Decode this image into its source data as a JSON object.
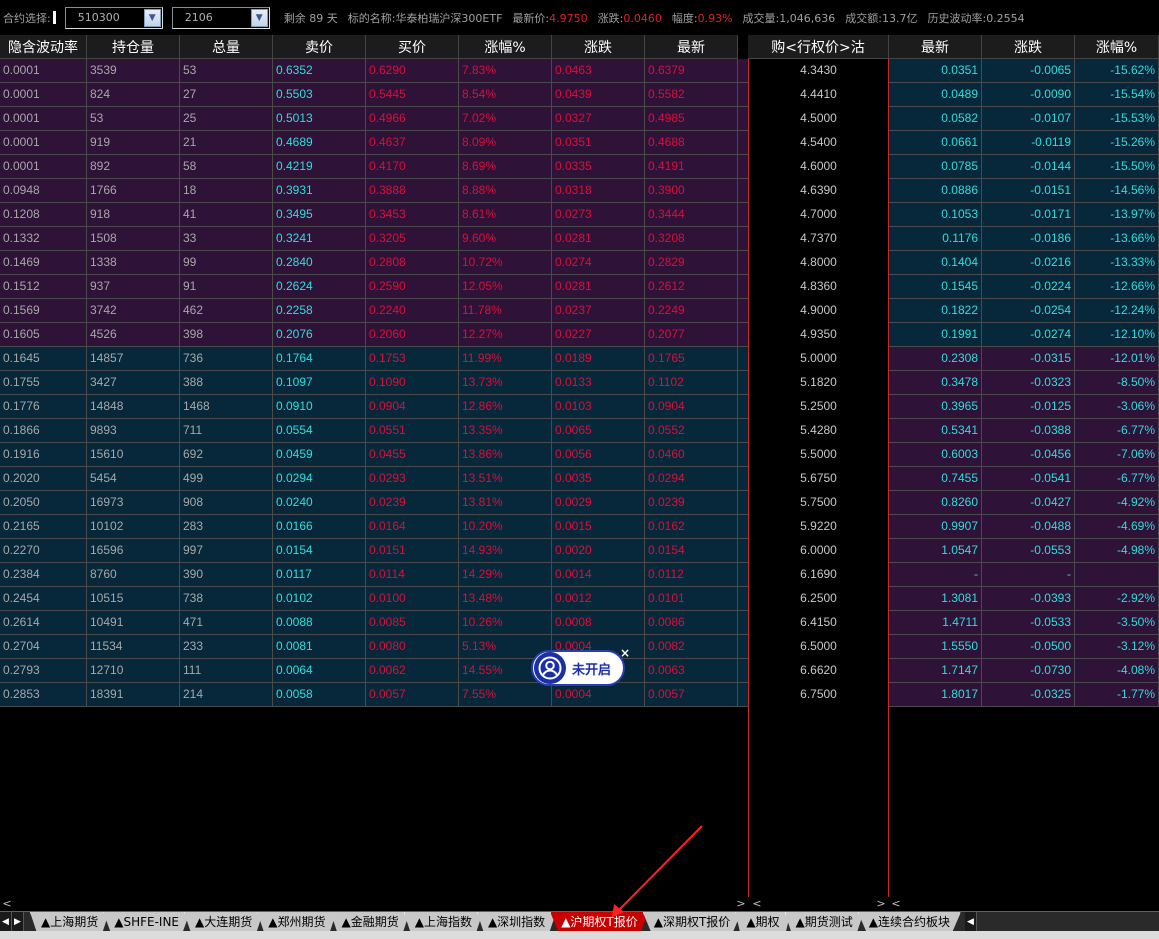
{
  "topbar": {
    "contract_label": "合约选择:",
    "underlying_code": "510300",
    "month_code": "2106",
    "remaining": "剩余 89 天",
    "target_label": "标的名称:",
    "target_name": "华泰柏瑞沪深300ETF",
    "latest_label": "最新价:",
    "latest_value": "4.9750",
    "change_label": "涨跌:",
    "change_value": "0.0460",
    "amp_label": "幅度:",
    "amp_value": "0.93%",
    "volume_label": "成交量:",
    "volume_value": "1,046,636",
    "turnover_label": "成交额:",
    "turnover_value": "13.7亿",
    "hv_label": "历史波动率:",
    "hv_value": "0.2554"
  },
  "headers": {
    "call": [
      "隐含波动率",
      "持仓量",
      "总量",
      "卖价",
      "买价",
      "涨幅%",
      "涨跌",
      "最新"
    ],
    "strike": "购<行权价>沽",
    "put": [
      "最新",
      "涨跌",
      "涨幅%"
    ]
  },
  "rows": [
    {
      "iv": "0.0001",
      "oi": "3539",
      "vol": "53",
      "ask": "0.6352",
      "bid": "0.6290",
      "pct": "7.83%",
      "chg": "0.0463",
      "last": "0.6379",
      "strike": "4.3430",
      "p_last": "0.0351",
      "p_chg": "-0.0065",
      "p_pct": "-15.62%"
    },
    {
      "iv": "0.0001",
      "oi": "824",
      "vol": "27",
      "ask": "0.5503",
      "bid": "0.5445",
      "pct": "8.54%",
      "chg": "0.0439",
      "last": "0.5582",
      "strike": "4.4410",
      "p_last": "0.0489",
      "p_chg": "-0.0090",
      "p_pct": "-15.54%"
    },
    {
      "iv": "0.0001",
      "oi": "53",
      "vol": "25",
      "ask": "0.5013",
      "bid": "0.4966",
      "pct": "7.02%",
      "chg": "0.0327",
      "last": "0.4985",
      "strike": "4.5000",
      "p_last": "0.0582",
      "p_chg": "-0.0107",
      "p_pct": "-15.53%"
    },
    {
      "iv": "0.0001",
      "oi": "919",
      "vol": "21",
      "ask": "0.4689",
      "bid": "0.4637",
      "pct": "8.09%",
      "chg": "0.0351",
      "last": "0.4688",
      "strike": "4.5400",
      "p_last": "0.0661",
      "p_chg": "-0.0119",
      "p_pct": "-15.26%"
    },
    {
      "iv": "0.0001",
      "oi": "892",
      "vol": "58",
      "ask": "0.4219",
      "bid": "0.4170",
      "pct": "8.69%",
      "chg": "0.0335",
      "last": "0.4191",
      "strike": "4.6000",
      "p_last": "0.0785",
      "p_chg": "-0.0144",
      "p_pct": "-15.50%"
    },
    {
      "iv": "0.0948",
      "oi": "1766",
      "vol": "18",
      "ask": "0.3931",
      "bid": "0.3888",
      "pct": "8.88%",
      "chg": "0.0318",
      "last": "0.3900",
      "strike": "4.6390",
      "p_last": "0.0886",
      "p_chg": "-0.0151",
      "p_pct": "-14.56%"
    },
    {
      "iv": "0.1208",
      "oi": "918",
      "vol": "41",
      "ask": "0.3495",
      "bid": "0.3453",
      "pct": "8.61%",
      "chg": "0.0273",
      "last": "0.3444",
      "strike": "4.7000",
      "p_last": "0.1053",
      "p_chg": "-0.0171",
      "p_pct": "-13.97%"
    },
    {
      "iv": "0.1332",
      "oi": "1508",
      "vol": "33",
      "ask": "0.3241",
      "bid": "0.3205",
      "pct": "9.60%",
      "chg": "0.0281",
      "last": "0.3208",
      "strike": "4.7370",
      "p_last": "0.1176",
      "p_chg": "-0.0186",
      "p_pct": "-13.66%"
    },
    {
      "iv": "0.1469",
      "oi": "1338",
      "vol": "99",
      "ask": "0.2840",
      "bid": "0.2808",
      "pct": "10.72%",
      "chg": "0.0274",
      "last": "0.2829",
      "strike": "4.8000",
      "p_last": "0.1404",
      "p_chg": "-0.0216",
      "p_pct": "-13.33%"
    },
    {
      "iv": "0.1512",
      "oi": "937",
      "vol": "91",
      "ask": "0.2624",
      "bid": "0.2590",
      "pct": "12.05%",
      "chg": "0.0281",
      "last": "0.2612",
      "strike": "4.8360",
      "p_last": "0.1545",
      "p_chg": "-0.0224",
      "p_pct": "-12.66%"
    },
    {
      "iv": "0.1569",
      "oi": "3742",
      "vol": "462",
      "ask": "0.2258",
      "bid": "0.2240",
      "pct": "11.78%",
      "chg": "0.0237",
      "last": "0.2249",
      "strike": "4.9000",
      "p_last": "0.1822",
      "p_chg": "-0.0254",
      "p_pct": "-12.24%"
    },
    {
      "iv": "0.1605",
      "oi": "4526",
      "vol": "398",
      "ask": "0.2076",
      "bid": "0.2060",
      "pct": "12.27%",
      "chg": "0.0227",
      "last": "0.2077",
      "strike": "4.9350",
      "p_last": "0.1991",
      "p_chg": "-0.0274",
      "p_pct": "-12.10%"
    },
    {
      "iv": "0.1645",
      "oi": "14857",
      "vol": "736",
      "ask": "0.1764",
      "bid": "0.1753",
      "pct": "11.99%",
      "chg": "0.0189",
      "last": "0.1765",
      "strike": "5.0000",
      "p_last": "0.2308",
      "p_chg": "-0.0315",
      "p_pct": "-12.01%"
    },
    {
      "iv": "0.1755",
      "oi": "3427",
      "vol": "388",
      "ask": "0.1097",
      "bid": "0.1090",
      "pct": "13.73%",
      "chg": "0.0133",
      "last": "0.1102",
      "strike": "5.1820",
      "p_last": "0.3478",
      "p_chg": "-0.0323",
      "p_pct": "-8.50%"
    },
    {
      "iv": "0.1776",
      "oi": "14848",
      "vol": "1468",
      "ask": "0.0910",
      "bid": "0.0904",
      "pct": "12.86%",
      "chg": "0.0103",
      "last": "0.0904",
      "strike": "5.2500",
      "p_last": "0.3965",
      "p_chg": "-0.0125",
      "p_pct": "-3.06%"
    },
    {
      "iv": "0.1866",
      "oi": "9893",
      "vol": "711",
      "ask": "0.0554",
      "bid": "0.0551",
      "pct": "13.35%",
      "chg": "0.0065",
      "last": "0.0552",
      "strike": "5.4280",
      "p_last": "0.5341",
      "p_chg": "-0.0388",
      "p_pct": "-6.77%"
    },
    {
      "iv": "0.1916",
      "oi": "15610",
      "vol": "692",
      "ask": "0.0459",
      "bid": "0.0455",
      "pct": "13.86%",
      "chg": "0.0056",
      "last": "0.0460",
      "strike": "5.5000",
      "p_last": "0.6003",
      "p_chg": "-0.0456",
      "p_pct": "-7.06%"
    },
    {
      "iv": "0.2020",
      "oi": "5454",
      "vol": "499",
      "ask": "0.0294",
      "bid": "0.0293",
      "pct": "13.51%",
      "chg": "0.0035",
      "last": "0.0294",
      "strike": "5.6750",
      "p_last": "0.7455",
      "p_chg": "-0.0541",
      "p_pct": "-6.77%"
    },
    {
      "iv": "0.2050",
      "oi": "16973",
      "vol": "908",
      "ask": "0.0240",
      "bid": "0.0239",
      "pct": "13.81%",
      "chg": "0.0029",
      "last": "0.0239",
      "strike": "5.7500",
      "p_last": "0.8260",
      "p_chg": "-0.0427",
      "p_pct": "-4.92%"
    },
    {
      "iv": "0.2165",
      "oi": "10102",
      "vol": "283",
      "ask": "0.0166",
      "bid": "0.0164",
      "pct": "10.20%",
      "chg": "0.0015",
      "last": "0.0162",
      "strike": "5.9220",
      "p_last": "0.9907",
      "p_chg": "-0.0488",
      "p_pct": "-4.69%"
    },
    {
      "iv": "0.2270",
      "oi": "16596",
      "vol": "997",
      "ask": "0.0154",
      "bid": "0.0151",
      "pct": "14.93%",
      "chg": "0.0020",
      "last": "0.0154",
      "strike": "6.0000",
      "p_last": "1.0547",
      "p_chg": "-0.0553",
      "p_pct": "-4.98%"
    },
    {
      "iv": "0.2384",
      "oi": "8760",
      "vol": "390",
      "ask": "0.0117",
      "bid": "0.0114",
      "pct": "14.29%",
      "chg": "0.0014",
      "last": "0.0112",
      "strike": "6.1690",
      "p_last": "-",
      "p_chg": "-",
      "p_pct": ""
    },
    {
      "iv": "0.2454",
      "oi": "10515",
      "vol": "738",
      "ask": "0.0102",
      "bid": "0.0100",
      "pct": "13.48%",
      "chg": "0.0012",
      "last": "0.0101",
      "strike": "6.2500",
      "p_last": "1.3081",
      "p_chg": "-0.0393",
      "p_pct": "-2.92%"
    },
    {
      "iv": "0.2614",
      "oi": "10491",
      "vol": "471",
      "ask": "0.0088",
      "bid": "0.0085",
      "pct": "10.26%",
      "chg": "0.0008",
      "last": "0.0086",
      "strike": "6.4150",
      "p_last": "1.4711",
      "p_chg": "-0.0533",
      "p_pct": "-3.50%"
    },
    {
      "iv": "0.2704",
      "oi": "11534",
      "vol": "233",
      "ask": "0.0081",
      "bid": "0.0080",
      "pct": "5.13%",
      "chg": "0.0004",
      "last": "0.0082",
      "strike": "6.5000",
      "p_last": "1.5550",
      "p_chg": "-0.0500",
      "p_pct": "-3.12%"
    },
    {
      "iv": "0.2793",
      "oi": "12710",
      "vol": "111",
      "ask": "0.0064",
      "bid": "0.0062",
      "pct": "14.55%",
      "chg": "0.0008",
      "last": "0.0063",
      "strike": "6.6620",
      "p_last": "1.7147",
      "p_chg": "-0.0730",
      "p_pct": "-4.08%"
    },
    {
      "iv": "0.2853",
      "oi": "18391",
      "vol": "214",
      "ask": "0.0058",
      "bid": "0.0057",
      "pct": "7.55%",
      "chg": "0.0004",
      "last": "0.0057",
      "strike": "6.7500",
      "p_last": "1.8017",
      "p_chg": "-0.0325",
      "p_pct": "-1.77%"
    }
  ],
  "itm_call_rows": 12,
  "float_widget": {
    "label": "未开启",
    "close": "×"
  },
  "tabs": [
    {
      "label": "▲上海期货",
      "active": false
    },
    {
      "label": "▲SHFE-INE",
      "active": false
    },
    {
      "label": "▲大连期货",
      "active": false
    },
    {
      "label": "▲郑州期货",
      "active": false
    },
    {
      "label": "▲金融期货",
      "active": false
    },
    {
      "label": "▲上海指数",
      "active": false
    },
    {
      "label": "▲深圳指数",
      "active": false
    },
    {
      "label": "▲沪期权T报价",
      "active": true
    },
    {
      "label": "▲深期权T报价",
      "active": false
    },
    {
      "label": "▲期权",
      "active": false
    },
    {
      "label": "▲期货测试",
      "active": false
    },
    {
      "label": "▲连续合约板块",
      "active": false
    }
  ],
  "colors": {
    "itm_bg": "#2e1237",
    "otm_bg": "#06283a",
    "cyan": "#32dcdc",
    "red": "#d8103a",
    "active_tab": "#c80000"
  }
}
